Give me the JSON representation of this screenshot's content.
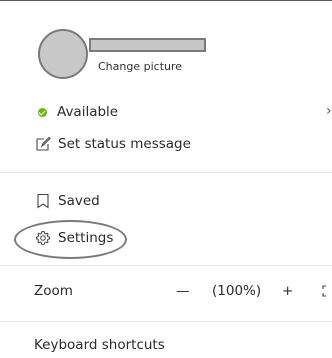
{
  "profile": {
    "change_picture_label": "Change picture"
  },
  "status": {
    "available_label": "Available",
    "available_color": "#6bb700",
    "set_status_label": "Set status message",
    "chevron": "›"
  },
  "menu": {
    "saved_label": "Saved",
    "settings_label": "Settings"
  },
  "zoom": {
    "label": "Zoom",
    "minus": "—",
    "value": "(100%)",
    "plus": "+"
  },
  "keyboard_shortcuts_label": "Keyboard shortcuts"
}
